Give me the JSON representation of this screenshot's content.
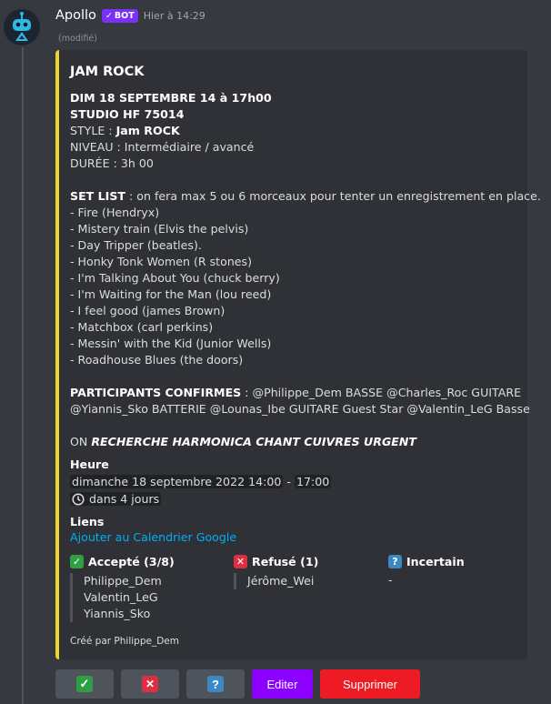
{
  "message": {
    "author": "Apollo",
    "bot_badge": "BOT",
    "timestamp": "Hier à 14:29",
    "edited": "(modifié)"
  },
  "embed": {
    "accent_color": "#f0d429",
    "title": "JAM ROCK",
    "date_line": "DIM 18 SEPTEMBRE 14 à 17h00",
    "studio_line": "STUDIO HF 75014",
    "style_label": "STYLE : ",
    "style_value": "Jam ROCK",
    "level": "NIVEAU : Intermédiaire / avancé",
    "duration": "DURÉE : 3h 00",
    "setlist_label": "SET LIST",
    "setlist_intro": " : on fera max 5 ou 6 morceaux pour tenter un enregistrement en place.",
    "songs": [
      "- Fire (Hendryx)",
      "- Mistery train (Elvis the pelvis)",
      "- Day Tripper (beatles).",
      "- Honky Tonk Women (R stones)",
      "- I'm Talking About You (chuck berry)",
      "- I'm Waiting for the Man (lou reed)",
      "- I feel good (james Brown)",
      "- Matchbox (carl perkins)",
      "- Messin' with the Kid (Junior Wells)",
      "- Roadhouse Blues (the doors)"
    ],
    "participants_label": "PARTICIPANTS CONFIRMES",
    "participants_line1": " : @Philippe_Dem BASSE @Charles_Roc GUITARE",
    "participants_line2": "@Yiannis_Sko BATTERIE @Lounas_Ibe GUITARE Guest Star @Valentin_LeG Basse",
    "search_prefix": "ON ",
    "search_text": "RECHERCHE HARMONICA CHANT CUIVRES URGENT",
    "time_field": {
      "name": "Heure",
      "start": "dimanche 18 septembre 2022 14:00",
      "separator": " - ",
      "end": "17:00",
      "relative": "dans 4 jours"
    },
    "links_field": {
      "name": "Liens",
      "google_calendar": "Ajouter au Calendrier Google"
    },
    "rsvp": {
      "accepted": {
        "label": "Accepté (3/8)",
        "names": [
          "Philippe_Dem",
          "Valentin_LeG",
          "Yiannis_Sko"
        ]
      },
      "declined": {
        "label": "Refusé (1)",
        "names": [
          "Jérôme_Wei"
        ]
      },
      "tentative": {
        "label": "Incertain",
        "placeholder": "-"
      }
    },
    "footer": "Créé par Philippe_Dem"
  },
  "buttons": {
    "accept_symbol": "✓",
    "decline_symbol": "✕",
    "tentative_symbol": "?",
    "edit_label": "Editer",
    "delete_label": "Supprimer"
  }
}
